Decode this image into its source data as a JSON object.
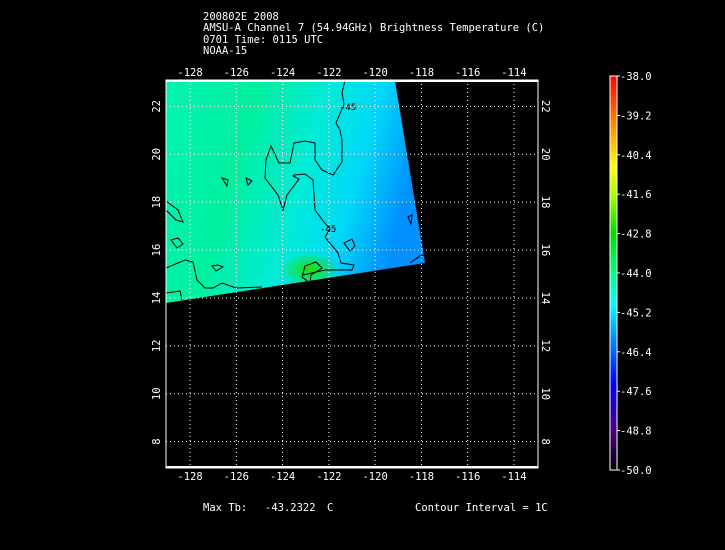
{
  "header": {
    "line1": "200802E 2008",
    "line2": "AMSU-A Channel 7 (54.94GHz) Brightness Temperature (C)",
    "line3": "0701 Time: 0115 UTC",
    "line4": "NOAA-15"
  },
  "footer": {
    "max_label": "Max Tb:",
    "max_value": "-43.2322",
    "max_unit": "C",
    "contour": "Contour Interval = 1C"
  },
  "chart_data": {
    "type": "heatmap",
    "title": "AMSU-A Channel 7 (54.94GHz) Brightness Temperature (C)",
    "x_ticks": [
      "-128",
      "-126",
      "-124",
      "-122",
      "-120",
      "-118",
      "-116",
      "-114"
    ],
    "x_tick_values": [
      -128,
      -126,
      -124,
      -122,
      -120,
      -118,
      -116,
      -114
    ],
    "y_ticks": [
      "8",
      "10",
      "12",
      "14",
      "16",
      "18",
      "20",
      "22"
    ],
    "y_tick_values": [
      8,
      10,
      12,
      14,
      16,
      18,
      20,
      22
    ],
    "xlim": [
      -129.04,
      -112.96
    ],
    "ylim": [
      6.9,
      23.1
    ],
    "grid": true,
    "contour_labels": [
      "-45",
      "-45"
    ],
    "colorbar": {
      "ticks": [
        "-38.0",
        "-39.2",
        "-40.4",
        "-41.6",
        "-42.8",
        "-44.0",
        "-45.2",
        "-46.4",
        "-47.6",
        "-48.8",
        "-50.0"
      ],
      "range": [
        -50.0,
        -38.0
      ],
      "colors": [
        "#000000",
        "#4b0082",
        "#0000ff",
        "#00aaff",
        "#00ffff",
        "#00ff88",
        "#00dd00",
        "#aaff00",
        "#ffff00",
        "#ff8800",
        "#ff0000"
      ]
    },
    "swath_max": -43.2322
  }
}
